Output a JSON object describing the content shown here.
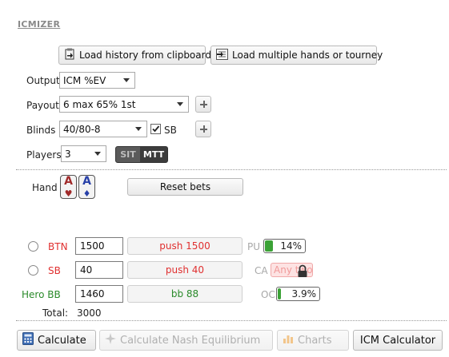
{
  "title": "ICMIZER",
  "load_history_label": "Load history from clipboard",
  "load_multiple_label": "Load multiple hands or tourney",
  "output": {
    "label": "Output",
    "value": "ICM %EV"
  },
  "payout": {
    "label": "Payout",
    "value": "6 max 65% 1st"
  },
  "blinds": {
    "label": "Blinds",
    "value": "40/80-8",
    "sb_label": "SB",
    "sb_checked": true
  },
  "players": {
    "label": "Players",
    "value": "3",
    "toggle_left": "SIT",
    "toggle_right": "MTT"
  },
  "hand": {
    "label": "Hand",
    "card1": "A",
    "card2": "A",
    "reset_label": "Reset bets"
  },
  "rows": [
    {
      "label": "BTN",
      "stack": "1500",
      "action": "push 1500",
      "stat_label": "PU",
      "stat_value": "14%",
      "fill": 0.14
    },
    {
      "label": "SB",
      "stack": "40",
      "action": "push 40",
      "stat_label": "CA",
      "stat_value": "Any two"
    },
    {
      "label": "Hero BB",
      "stack": "1460",
      "action": "bb 88",
      "stat_label": "OC",
      "stat_value": "3.9%",
      "fill": 0.039
    }
  ],
  "total_label": "Total:",
  "total_value": "3000",
  "bottom": {
    "calculate": "Calculate",
    "nash": "Calculate Nash Equilibrium",
    "charts": "Charts",
    "icm": "ICM Calculator"
  },
  "colors": {
    "red_action": "#e03030",
    "green_action": "#2a8a2a",
    "fill_green": "#3ba236"
  }
}
